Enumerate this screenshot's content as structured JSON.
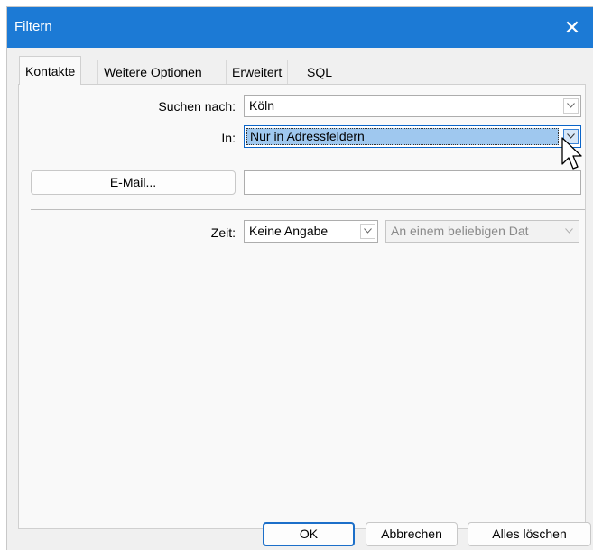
{
  "dialog": {
    "title": "Filtern",
    "close_glyph": "✕"
  },
  "tabs": [
    {
      "label": "Kontakte",
      "active": true
    },
    {
      "label": "Weitere Optionen",
      "active": false
    },
    {
      "label": "Erweitert",
      "active": false
    },
    {
      "label": "SQL",
      "active": false
    }
  ],
  "search": {
    "label": "Suchen nach:",
    "value": "Köln"
  },
  "in_field": {
    "label": "In:",
    "value": "Nur in Adressfeldern"
  },
  "email": {
    "button_label": "E-Mail...",
    "value": ""
  },
  "time": {
    "label": "Zeit:",
    "value": "Keine Angabe",
    "date_value": "An einem beliebigen Dat"
  },
  "footer": {
    "ok_label": "OK",
    "cancel_label": "Abbrechen",
    "clear_label": "Alles löschen"
  },
  "colors": {
    "titlebar": "#1c7ad5",
    "selection": "#9fc8ef",
    "primary_border": "#1c6fc9"
  },
  "icons": {
    "close": "close-icon",
    "dropdown": "chevron-down-icon",
    "cursor": "mouse-cursor-icon"
  }
}
